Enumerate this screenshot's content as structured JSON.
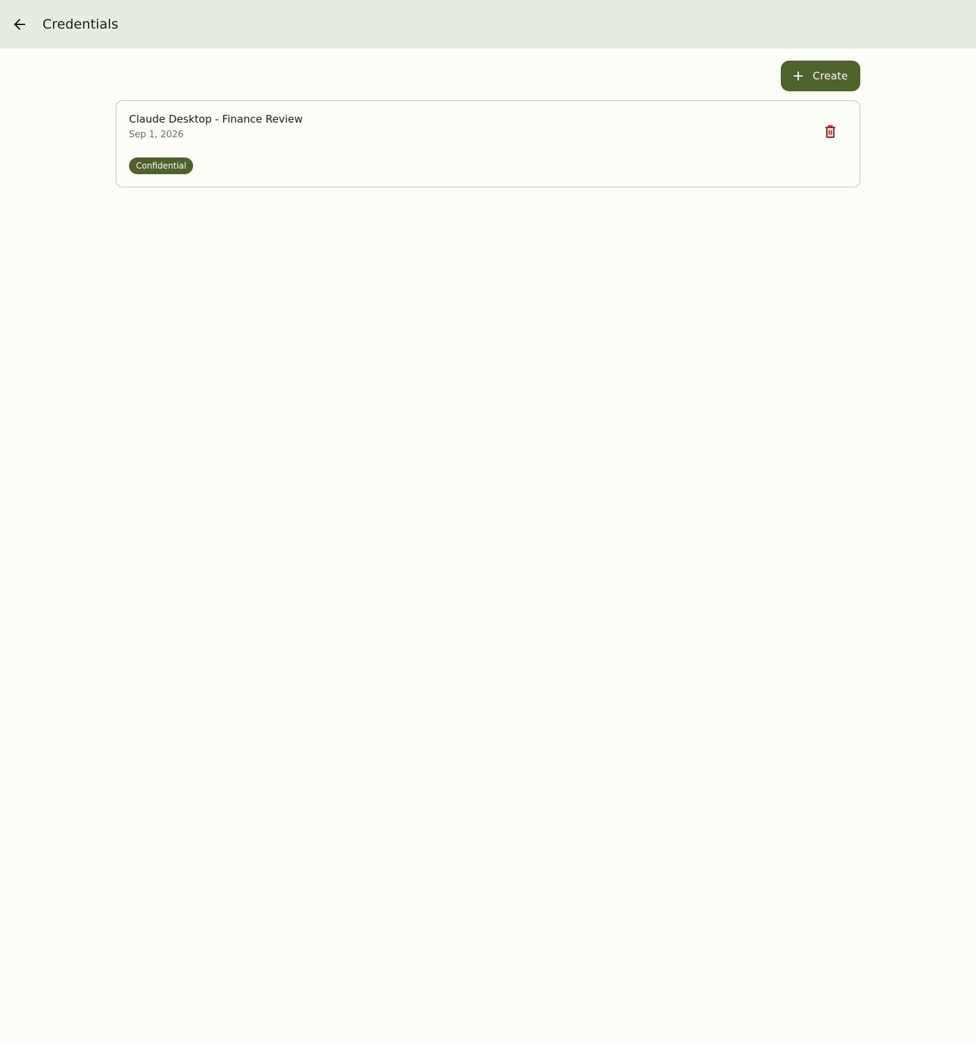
{
  "header": {
    "title": "Credentials",
    "back_icon": "arrow-left-icon"
  },
  "toolbar": {
    "create_label": "Create",
    "create_icon": "plus-icon"
  },
  "credentials": [
    {
      "name": "Claude Desktop - Finance Review",
      "date": "Sep 1, 2026",
      "tag": "Confidential",
      "delete_icon": "trash-icon"
    }
  ],
  "colors": {
    "primary": "#4c6329",
    "topbar_bg": "#e6ece0",
    "page_bg": "#fcfdf7",
    "danger": "#ba1a1a"
  }
}
